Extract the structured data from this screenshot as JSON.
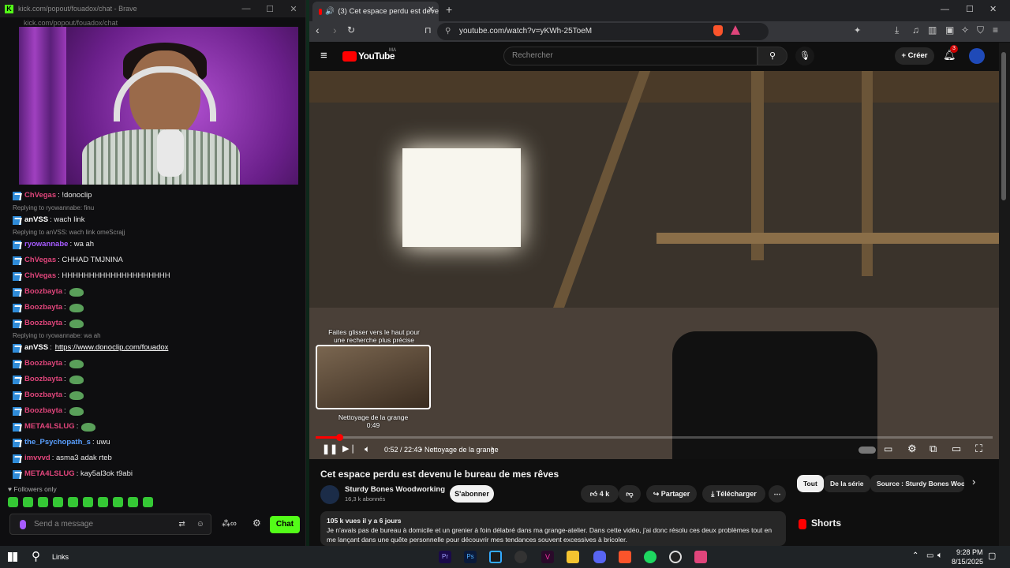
{
  "left_window": {
    "title": "kick.com/popout/fouadox/chat - Brave",
    "url": "kick.com/popout/fouadox/chat",
    "brand_color": "#53fc18",
    "chat_messages": [
      {
        "user": "ChVegas",
        "color": "#e0457b",
        "text": ": !donoclip"
      },
      {
        "reply_to": "Replying to ryowannabe: finu"
      },
      {
        "user": "anVSS",
        "color": "#ffffff",
        "text": ": wach link"
      },
      {
        "reply_to": "Replying to anVSS: wach link omeScrajj"
      },
      {
        "user": "ryowannabe",
        "color": "#a65bff",
        "text": ": wa ah"
      },
      {
        "user": "ChVegas",
        "color": "#e0457b",
        "text": ": CHHAD TMJNINA"
      },
      {
        "user": "ChVegas",
        "color": "#e0457b",
        "text": ": HHHHHHHHHHHHHHHHHHHH"
      },
      {
        "user": "Boozbayta",
        "color": "#e0457b",
        "text": ":"
      },
      {
        "user": "Boozbayta",
        "color": "#e0457b",
        "text": ":"
      },
      {
        "user": "Boozbayta",
        "color": "#e0457b",
        "text": ":"
      },
      {
        "reply_to": "Replying to ryowannabe: wa ah"
      },
      {
        "user": "anVSS",
        "color": "#ffffff",
        "text": ":",
        "link": "https://www.donoclip.com/fouadox"
      },
      {
        "user": "Boozbayta",
        "color": "#e0457b",
        "text": ":"
      },
      {
        "user": "Boozbayta",
        "color": "#e0457b",
        "text": ":"
      },
      {
        "user": "Boozbayta",
        "color": "#e0457b",
        "text": ":"
      },
      {
        "user": "Boozbayta",
        "color": "#e0457b",
        "text": ":"
      },
      {
        "user": "META4LSLUG",
        "color": "#e0457b",
        "text": ":"
      },
      {
        "user": "the_Psychopath_s",
        "color": "#5aa0ff",
        "text": ": uwu"
      },
      {
        "user": "imvvvd",
        "color": "#e0457b",
        "text": ": asma3 adak rteb"
      },
      {
        "user": "META4LSLUG",
        "color": "#e0457b",
        "text": ": kay5al3ok t9abi"
      }
    ],
    "followers_only": "Followers only",
    "chat_placeholder": "Send a message",
    "chat_button": "Chat"
  },
  "right_window": {
    "tab_title": "(3) Cet espace perdu est deve",
    "url": "youtube.com/watch?v=yKWh-25ToeM",
    "youtube": {
      "logo": "YouTube",
      "region": "MA",
      "search_placeholder": "Rechercher",
      "create": "Créer",
      "notifications": "3",
      "accent": "#ff0000"
    },
    "player": {
      "preview_hint": "Faites glisser vers le haut pour une recherche plus précise",
      "preview_chapter": "Nettoyage de la grange",
      "preview_time": "0:49",
      "time": "0:52 / 22:43",
      "chapter": "Nettoyage de la grange",
      "progress": 0.038
    },
    "video": {
      "title": "Cet espace perdu est devenu le bureau de mes rêves",
      "channel": "Sturdy Bones Woodworking",
      "subscribers": "16,3 k abonnés",
      "subscribe": "S'abonner",
      "likes": "4 k",
      "share": "Partager",
      "download": "Télécharger",
      "views": "105 k vues  il y a 6 jours",
      "description": "Je n'avais pas de bureau à domicile et un grenier à foin délabré dans ma grange-atelier. Dans cette vidéo, j'ai donc résolu ces deux problèmes tout en me lançant dans une quête personnelle pour découvrir mes tendances souvent excessives à bricoler."
    },
    "chips": [
      "Tout",
      "De la série",
      "Source : Sturdy Bones Woo"
    ],
    "shorts": "Shorts"
  },
  "taskbar": {
    "links": "Links",
    "time": "9:28 PM",
    "date": "8/15/2025"
  }
}
